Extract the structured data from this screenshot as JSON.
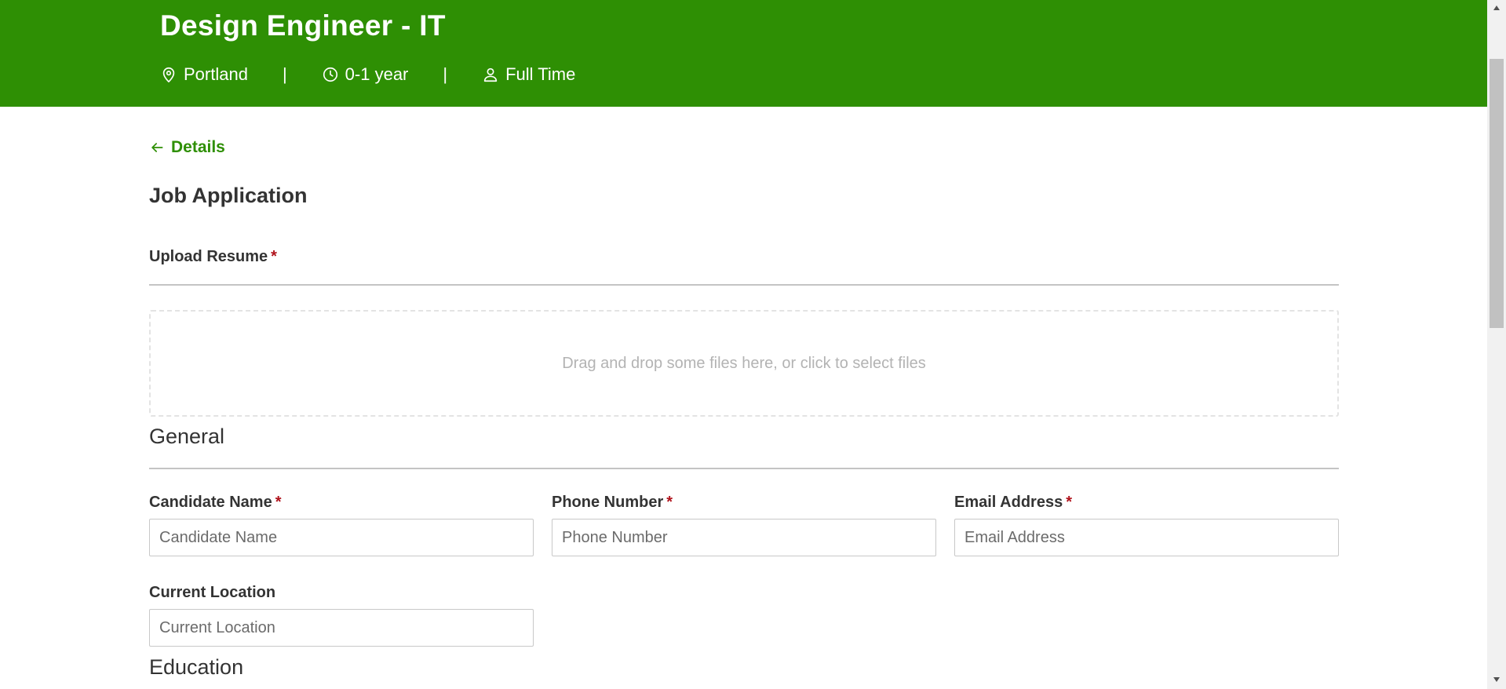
{
  "header": {
    "title": "Design Engineer - IT",
    "location": "Portland",
    "experience": "0-1 year",
    "job_type": "Full Time",
    "separator": "|",
    "background_color": "#2e8f04"
  },
  "nav": {
    "back_label": "Details"
  },
  "page": {
    "title": "Job Application"
  },
  "resume": {
    "label": "Upload Resume",
    "required_mark": "*",
    "dropzone_text": "Drag and drop some files here, or click to select files"
  },
  "sections": {
    "general": "General",
    "education": "Education"
  },
  "fields": {
    "candidate_name": {
      "label": "Candidate Name",
      "required_mark": "*",
      "placeholder": "Candidate Name"
    },
    "phone_number": {
      "label": "Phone Number",
      "required_mark": "*",
      "placeholder": "Phone Number"
    },
    "email_address": {
      "label": "Email Address",
      "required_mark": "*",
      "placeholder": "Email Address"
    },
    "current_location": {
      "label": "Current Location",
      "placeholder": "Current Location"
    }
  },
  "icons": {
    "location": "map-pin-icon",
    "experience": "clock-icon",
    "job_type": "user-icon",
    "back": "arrow-left-icon"
  }
}
